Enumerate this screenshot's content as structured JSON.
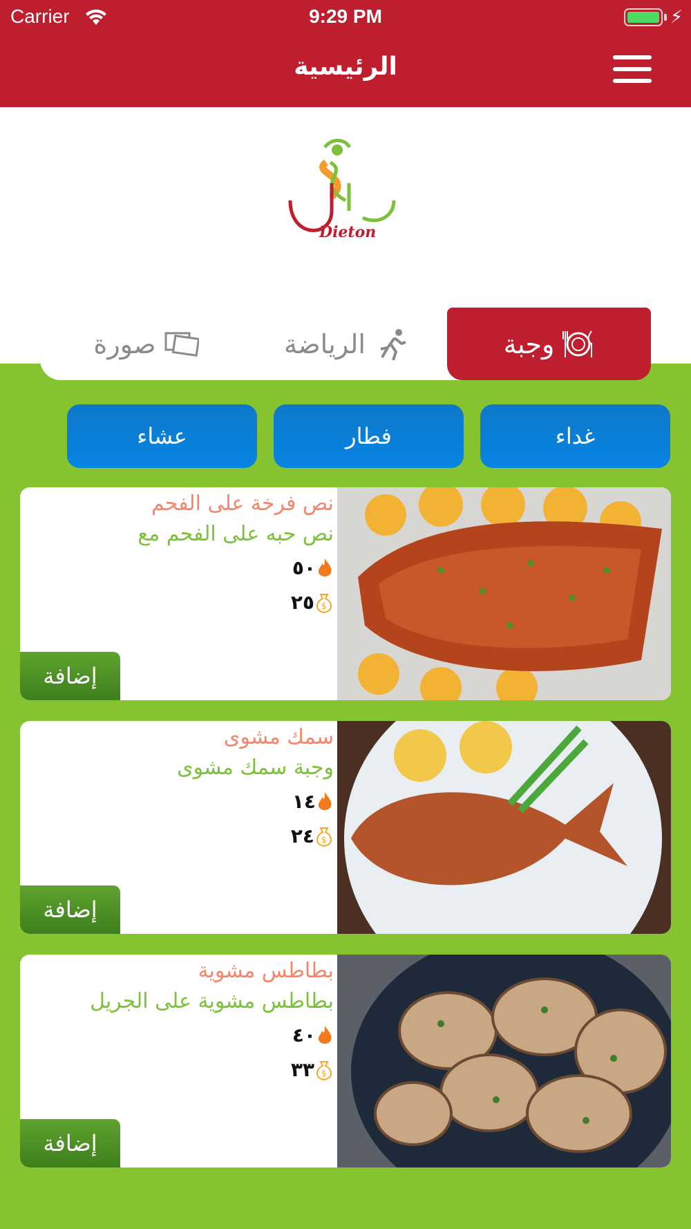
{
  "status_bar": {
    "carrier": "Carrier",
    "time": "9:29 PM"
  },
  "header": {
    "title": "الرئيسية",
    "menu_icon": "hamburger-menu-icon"
  },
  "logo": {
    "text_ar": "دايتون",
    "text_en": "Dieton"
  },
  "tabs": [
    {
      "label": "وجبة",
      "icon": "meal-plate-icon",
      "active": true
    },
    {
      "label": "الرياضة",
      "icon": "running-person-icon",
      "active": false
    },
    {
      "label": "صورة",
      "icon": "photos-icon",
      "active": false
    }
  ],
  "meal_types": [
    "غداء",
    "فطار",
    "عشاء"
  ],
  "meals": [
    {
      "title": "نص فرخة على الفحم",
      "description": "نص حبه على الفحم مع",
      "calories": "٥٠",
      "price": "٢٥",
      "add_label": "إضافة",
      "image": "grilled-salmon-photo"
    },
    {
      "title": "سمك مشوى",
      "description": "وجبة سمك مشوى",
      "calories": "١٤",
      "price": "٢٤",
      "add_label": "إضافة",
      "image": "grilled-fish-photo"
    },
    {
      "title": "بطاطس مشوية",
      "description": "بطاطس مشوية على الجريل",
      "calories": "٤٠",
      "price": "٣٣",
      "add_label": "إضافة",
      "image": "roasted-potatoes-photo"
    }
  ],
  "colors": {
    "header": "#be1e2d",
    "background_green": "#86c330",
    "meal_button": "#0a7fd6",
    "add_button": "#4a8d22",
    "title_orange": "#f5856b",
    "desc_green": "#7cc13a"
  }
}
